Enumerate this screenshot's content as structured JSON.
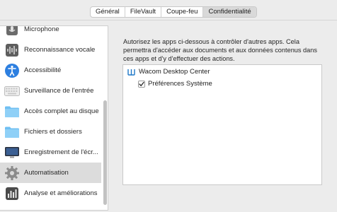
{
  "tabs": [
    {
      "label": "Général",
      "active": false
    },
    {
      "label": "FileVault",
      "active": false
    },
    {
      "label": "Coupe-feu",
      "active": false
    },
    {
      "label": "Confidentialité",
      "active": true
    }
  ],
  "sidebar": {
    "items": [
      {
        "label": "Microphone",
        "icon": "microphone-icon"
      },
      {
        "label": "Reconnaissance vocale",
        "icon": "waveform-icon"
      },
      {
        "label": "Accessibilité",
        "icon": "accessibility-icon"
      },
      {
        "label": "Surveillance de l'entrée",
        "icon": "keyboard-icon"
      },
      {
        "label": "Accès complet au disque",
        "icon": "folder-icon"
      },
      {
        "label": "Fichiers et dossiers",
        "icon": "folder-icon"
      },
      {
        "label": "Enregistrement de l'écr...",
        "icon": "display-icon"
      },
      {
        "label": "Automatisation",
        "icon": "gear-icon",
        "selected": true
      },
      {
        "label": "Analyse et améliorations",
        "icon": "chart-icon"
      }
    ]
  },
  "main": {
    "description": "Autorisez les apps ci-dessous à contrôler d'autres apps. Cela permettra d'accéder aux documents et aux données contenus dans ces apps et d'y d'effectuer des actions.",
    "apps": [
      {
        "name": "Wacom Desktop Center",
        "icon": "wacom-icon"
      },
      {
        "name": "Préférences Système",
        "checked": true
      }
    ]
  },
  "colors": {
    "folder": "#6fbff2",
    "accessibility": "#2d7fe0",
    "selected_row": "#dcdcdc"
  }
}
